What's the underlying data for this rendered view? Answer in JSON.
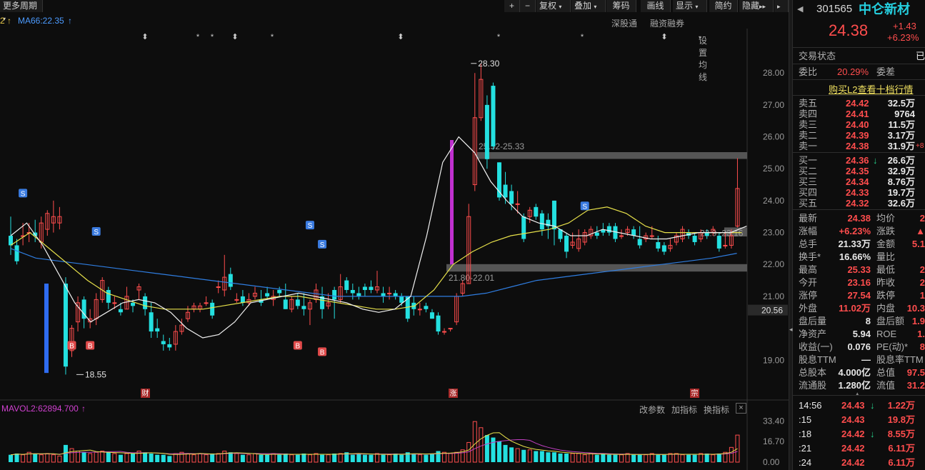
{
  "toolbar": {
    "period_label": "更多周期",
    "plus": "+",
    "minus": "−",
    "fq_label": "复权",
    "overlay_label": "叠加",
    "chips_label": "筹码",
    "draw_label": "画线",
    "display_label": "显示",
    "simple_label": "简约",
    "hide_label": "隐藏",
    "more_label": "▸▸"
  },
  "ma": {
    "ma_left": "2",
    "ma66_label": "MA66:22.35",
    "arrow": "↑"
  },
  "chart_links": {
    "shengu": "深股通",
    "rzrq": "融资融券",
    "settings": "设置均线"
  },
  "chart_data": {
    "type": "candlestick",
    "y_ticks": [
      "28.00",
      "27.00",
      "26.00",
      "25.00",
      "24.00",
      "23.00",
      "22.00",
      "21.00",
      "19.00"
    ],
    "current_price_tag": "20.56",
    "ylim": [
      18.2,
      28.9
    ],
    "annotations": {
      "high_label": "28.30",
      "low_label": "18.55",
      "upper_zone_label": "25.52-25.33",
      "lower_zone_label": "21.80-22.01",
      "right_zone_label": "22.9~23.16"
    },
    "event_labels": {
      "cai": "财",
      "zhang": "涨",
      "zong": "宗"
    },
    "signal_s": "S",
    "signal_b": "B",
    "star": "*",
    "diamond": "⬍",
    "volume": {
      "label": "MAVOL2:62894.700",
      "arrow": "↑",
      "ticks": [
        "33.40",
        "16.70",
        "0.00"
      ],
      "links": [
        "改参数",
        "加指标",
        "换指标"
      ],
      "close": "×"
    },
    "candles": [
      [
        22.9,
        22.6,
        23.5,
        22.3
      ],
      [
        22.6,
        22.1,
        22.8,
        22.0
      ],
      [
        22.9,
        22.9,
        23.3,
        22.6
      ],
      [
        23.0,
        23.0,
        23.3,
        22.7
      ],
      [
        23.0,
        22.9,
        23.4,
        22.7
      ],
      [
        22.7,
        23.3,
        23.5,
        22.5
      ],
      [
        23.1,
        23.6,
        23.7,
        22.9
      ],
      [
        23.3,
        23.5,
        24.0,
        23.0
      ],
      [
        23.3,
        23.5,
        23.8,
        23.1
      ],
      [
        21.4,
        18.8,
        21.6,
        18.55
      ],
      [
        19.3,
        20.0,
        20.1,
        19.1
      ],
      [
        20.2,
        20.8,
        21.0,
        19.9
      ],
      [
        20.9,
        20.3,
        21.0,
        20.0
      ],
      [
        20.2,
        20.3,
        20.6,
        20.0
      ],
      [
        20.3,
        20.9,
        21.1,
        20.1
      ],
      [
        20.9,
        21.5,
        21.6,
        20.8
      ],
      [
        21.2,
        20.8,
        21.3,
        20.6
      ],
      [
        20.8,
        20.8,
        21.0,
        20.6
      ],
      [
        20.6,
        20.5,
        20.8,
        20.4
      ],
      [
        20.6,
        21.0,
        21.3,
        20.6
      ],
      [
        20.8,
        20.7,
        20.9,
        20.5
      ],
      [
        21.2,
        21.3,
        21.4,
        20.9
      ],
      [
        21.0,
        20.6,
        21.1,
        20.4
      ],
      [
        20.5,
        19.9,
        20.8,
        19.7
      ],
      [
        20.0,
        19.9,
        20.3,
        19.7
      ],
      [
        19.6,
        19.5,
        19.8,
        19.3
      ],
      [
        19.5,
        19.4,
        19.7,
        19.3
      ],
      [
        19.5,
        19.9,
        20.1,
        19.3
      ],
      [
        19.9,
        20.1,
        20.3,
        19.8
      ],
      [
        20.3,
        20.5,
        20.7,
        20.2
      ],
      [
        20.6,
        20.7,
        20.8,
        20.5
      ],
      [
        20.6,
        20.7,
        20.8,
        20.5
      ],
      [
        20.8,
        20.8,
        21.0,
        20.7
      ],
      [
        20.8,
        20.4,
        20.9,
        20.3
      ],
      [
        21.3,
        21.3,
        21.5,
        21.1
      ],
      [
        21.2,
        21.6,
        22.3,
        21.0
      ],
      [
        21.7,
        21.3,
        21.9,
        21.2
      ],
      [
        20.9,
        20.9,
        21.1,
        20.8
      ],
      [
        21.0,
        20.8,
        21.2,
        20.7
      ],
      [
        20.8,
        20.9,
        21.1,
        20.7
      ],
      [
        21.0,
        21.1,
        21.3,
        20.9
      ],
      [
        20.9,
        20.8,
        21.2,
        20.7
      ],
      [
        21.1,
        21.0,
        21.3,
        20.9
      ],
      [
        20.9,
        21.0,
        21.2,
        20.7
      ],
      [
        21.2,
        21.1,
        21.3,
        21.0
      ],
      [
        20.9,
        20.6,
        21.4,
        20.6
      ],
      [
        20.6,
        20.9,
        21.0,
        20.5
      ],
      [
        20.9,
        20.7,
        21.1,
        20.6
      ],
      [
        20.7,
        20.6,
        21.1,
        20.4
      ],
      [
        20.6,
        20.8,
        20.9,
        20.1
      ],
      [
        20.9,
        21.2,
        21.4,
        20.8
      ],
      [
        21.0,
        20.6,
        21.3,
        20.3
      ],
      [
        20.7,
        20.8,
        21.1,
        20.6
      ],
      [
        21.2,
        20.9,
        21.3,
        20.3
      ],
      [
        20.9,
        21.3,
        21.7,
        20.8
      ],
      [
        21.5,
        21.2,
        21.6,
        21.1
      ],
      [
        21.2,
        21.1,
        21.4,
        20.9
      ],
      [
        21.1,
        21.0,
        21.3,
        20.9
      ],
      [
        21.3,
        21.2,
        21.4,
        21.0
      ],
      [
        21.3,
        21.2,
        21.5,
        21.1
      ],
      [
        21.2,
        21.3,
        21.8,
        21.1
      ],
      [
        21.1,
        21.0,
        21.3,
        20.8
      ],
      [
        21.1,
        21.1,
        21.3,
        20.9
      ],
      [
        21.1,
        21.0,
        21.2,
        20.9
      ],
      [
        21.0,
        20.8,
        21.1,
        20.7
      ],
      [
        21.0,
        20.3,
        21.0,
        20.2
      ],
      [
        20.8,
        20.6,
        21.0,
        20.4
      ],
      [
        20.6,
        20.6,
        20.8,
        20.4
      ],
      [
        20.7,
        20.6,
        20.8,
        20.5
      ],
      [
        20.5,
        20.3,
        20.6,
        20.3
      ],
      [
        20.4,
        19.9,
        20.5,
        19.8
      ],
      [
        19.9,
        19.9,
        20.0,
        19.8
      ],
      [
        20.0,
        20.0,
        20.0,
        19.9
      ],
      [
        20.2,
        21.0,
        21.1,
        20.1
      ],
      [
        21.1,
        21.4,
        21.5,
        21.0
      ],
      [
        21.4,
        23.5,
        23.9,
        21.4
      ],
      [
        24.5,
        26.6,
        28.0,
        24.3
      ],
      [
        26.6,
        27.8,
        28.3,
        26.5
      ],
      [
        27.0,
        25.3,
        27.3,
        25.0
      ],
      [
        27.6,
        25.7,
        27.7,
        25.6
      ],
      [
        25.2,
        24.1,
        25.2,
        24.0
      ],
      [
        24.5,
        24.1,
        24.9,
        23.9
      ],
      [
        24.3,
        23.9,
        24.5,
        23.7
      ],
      [
        23.9,
        23.9,
        24.3,
        23.6
      ],
      [
        23.5,
        22.8,
        23.6,
        22.7
      ],
      [
        23.5,
        23.7,
        23.8,
        23.3
      ],
      [
        23.8,
        23.5,
        23.9,
        23.4
      ],
      [
        23.6,
        23.1,
        23.7,
        22.9
      ],
      [
        23.4,
        23.2,
        23.6,
        22.8
      ],
      [
        24.0,
        23.1,
        24.0,
        22.6
      ],
      [
        23.1,
        22.8,
        23.1,
        22.7
      ],
      [
        22.9,
        22.4,
        23.0,
        22.2
      ],
      [
        22.6,
        22.7,
        23.0,
        22.5
      ],
      [
        22.5,
        22.8,
        23.1,
        22.4
      ],
      [
        22.7,
        23.0,
        23.1,
        22.6
      ],
      [
        22.9,
        23.1,
        23.2,
        22.8
      ],
      [
        23.0,
        22.9,
        23.2,
        22.8
      ],
      [
        23.1,
        23.0,
        23.3,
        22.9
      ],
      [
        23.2,
        23.0,
        23.3,
        22.9
      ],
      [
        23.2,
        22.8,
        23.3,
        22.7
      ],
      [
        22.9,
        22.9,
        23.1,
        22.8
      ],
      [
        23.0,
        23.1,
        23.2,
        22.9
      ],
      [
        23.1,
        22.9,
        23.2,
        22.8
      ],
      [
        22.8,
        22.6,
        23.2,
        22.5
      ],
      [
        22.8,
        22.9,
        23.0,
        22.7
      ],
      [
        22.9,
        22.9,
        23.2,
        22.8
      ],
      [
        22.7,
        22.5,
        22.9,
        22.4
      ],
      [
        22.6,
        22.4,
        22.7,
        22.3
      ],
      [
        22.5,
        22.6,
        22.8,
        22.4
      ],
      [
        22.7,
        22.9,
        23.0,
        22.6
      ],
      [
        22.8,
        23.1,
        23.2,
        22.7
      ],
      [
        23.0,
        22.9,
        23.1,
        22.8
      ],
      [
        22.9,
        22.7,
        23.0,
        22.6
      ],
      [
        22.8,
        23.0,
        23.1,
        22.7
      ],
      [
        23.0,
        22.9,
        23.1,
        22.8
      ],
      [
        23.0,
        23.1,
        23.2,
        22.9
      ],
      [
        22.9,
        22.5,
        23.0,
        22.4
      ],
      [
        22.6,
        22.6,
        23.0,
        22.5
      ],
      [
        22.6,
        22.9,
        23.1,
        22.5
      ],
      [
        23.2,
        24.38,
        25.33,
        23.16
      ]
    ],
    "lines": {
      "ma_white": [
        22.9,
        23.3,
        22.6,
        21.7,
        20.8,
        20.2,
        20.5,
        20.8,
        20.9,
        20.8,
        20.5,
        20.0,
        19.7,
        19.8,
        20.2,
        20.8,
        20.9,
        21.0,
        21.1,
        21.0,
        20.9,
        20.8,
        20.6,
        20.5,
        20.6,
        21.0,
        22.9,
        25.2,
        26.0,
        25.5,
        24.6,
        24.0,
        23.5,
        23.3,
        23.2,
        22.9,
        22.9,
        23.1,
        23.0,
        22.9,
        22.8,
        22.8,
        22.9,
        23.0,
        23.0,
        23.0,
        23.2
      ],
      "ma_yellow": [
        22.6,
        23.0,
        22.5,
        22.0,
        21.5,
        21.1,
        20.9,
        20.7,
        20.6,
        20.6,
        20.6,
        20.7,
        20.8,
        20.9,
        21.0,
        21.0,
        20.9,
        20.8,
        20.7,
        20.6,
        20.6,
        20.7,
        21.2,
        22.0,
        22.4,
        22.7,
        22.9,
        23.0,
        23.1,
        23.3,
        23.7,
        23.8,
        23.6,
        23.2,
        23.0,
        23.0,
        23.0,
        23.0,
        23.0
      ],
      "ma_blue": [
        22.5,
        22.2,
        22.1,
        22.0,
        21.9,
        21.8,
        21.7,
        21.6,
        21.5,
        21.4,
        21.3,
        21.2,
        21.1,
        21.0,
        21.0,
        21.0,
        21.0,
        21.0,
        21.0,
        21.1,
        21.3,
        21.5,
        21.6,
        21.7,
        21.8,
        21.9,
        22.0,
        22.1,
        22.2,
        22.35
      ]
    },
    "volumes": [
      6,
      7,
      6,
      8,
      7,
      6,
      7,
      6,
      5,
      14,
      11,
      9,
      8,
      7,
      8,
      9,
      8,
      7,
      6,
      7,
      7,
      9,
      8,
      7,
      6,
      6,
      5,
      7,
      8,
      7,
      6,
      7,
      6,
      7,
      7,
      9,
      8,
      7,
      6,
      6,
      7,
      6,
      6,
      7,
      6,
      7,
      6,
      6,
      7,
      6,
      7,
      6,
      6,
      7,
      7,
      8,
      6,
      7,
      6,
      6,
      7,
      6,
      6,
      7,
      6,
      8,
      7,
      6,
      6,
      7,
      9,
      8,
      7,
      8,
      10,
      16,
      33,
      28,
      22,
      20,
      17,
      14,
      12,
      11,
      10,
      10,
      9,
      9,
      8,
      8,
      7,
      7,
      7,
      7,
      6,
      7,
      6,
      7,
      6,
      6,
      6,
      7,
      6,
      6,
      6,
      7,
      6,
      6,
      7,
      7,
      6,
      6,
      6,
      7,
      7,
      6,
      7,
      8,
      12,
      22
    ]
  },
  "panel": {
    "code": "301565",
    "name": "中仑新材",
    "price": "24.38",
    "change": "+1.43",
    "change_pct": "+6.23%",
    "trade_status": "交易状态",
    "trade_status_val": "已",
    "weibi_label": "委比",
    "weibi_val": "20.29%",
    "weicha_label": "委差",
    "l2_link": "购买L2查看十档行情",
    "asks": [
      {
        "label": "卖五",
        "price": "24.42",
        "vol": "32.5万"
      },
      {
        "label": "卖四",
        "price": "24.41",
        "vol": "9764"
      },
      {
        "label": "卖三",
        "price": "24.40",
        "vol": "11.5万"
      },
      {
        "label": "卖二",
        "price": "24.39",
        "vol": "3.17万"
      },
      {
        "label": "卖一",
        "price": "24.38",
        "vol": "31.9万",
        "extra": "+8"
      }
    ],
    "bids": [
      {
        "label": "买一",
        "price": "24.36",
        "vol": "26.6万",
        "arrow": "↓"
      },
      {
        "label": "买二",
        "price": "24.35",
        "vol": "32.9万"
      },
      {
        "label": "买三",
        "price": "24.34",
        "vol": "8.76万"
      },
      {
        "label": "买四",
        "price": "24.33",
        "vol": "19.7万"
      },
      {
        "label": "买五",
        "price": "24.32",
        "vol": "32.6万"
      }
    ],
    "stats": [
      {
        "l": "最新",
        "v": "24.38",
        "vc": "red",
        "l2": "均价",
        "v2": "2"
      },
      {
        "l": "涨幅",
        "v": "+6.23%",
        "vc": "red",
        "l2": "涨跌",
        "v2": "▲"
      },
      {
        "l": "总手",
        "v": "21.33万",
        "vc": "white",
        "l2": "金额",
        "v2": "5.1"
      },
      {
        "l": "换手*",
        "v": "16.66%",
        "vc": "white",
        "l2": "量比",
        "v2": ""
      },
      {
        "l": "最高",
        "v": "25.33",
        "vc": "red",
        "l2": "最低",
        "v2": "2"
      },
      {
        "l": "今开",
        "v": "23.16",
        "vc": "red",
        "l2": "昨收",
        "v2": "2"
      },
      {
        "l": "涨停",
        "v": "27.54",
        "vc": "red",
        "l2": "跌停",
        "v2": "1"
      },
      {
        "l": "外盘",
        "v": "11.02万",
        "vc": "red",
        "l2": "内盘",
        "v2": "10.3"
      },
      {
        "l": "盘后量",
        "v": "8",
        "vc": "white",
        "l2": "盘后额",
        "v2": "1.9"
      },
      {
        "l": "净资产",
        "v": "5.94",
        "vc": "white",
        "l2": "ROE",
        "v2": "1."
      },
      {
        "l": "收益(一)",
        "v": "0.076",
        "vc": "white",
        "l2": "PE(动)*",
        "v2": "8"
      },
      {
        "l": "股息TTM",
        "v": "—",
        "vc": "white",
        "l2": "股息率TTM",
        "v2": ""
      },
      {
        "l": "总股本",
        "v": "4.000亿",
        "vc": "white",
        "l2": "总值",
        "v2": "97.5"
      },
      {
        "l": "流通股",
        "v": "1.280亿",
        "vc": "white",
        "l2": "流值",
        "v2": "31.2"
      }
    ],
    "ticks": [
      {
        "t": "14:56",
        "p": "24.43",
        "a": "↓",
        "v": "1.22万"
      },
      {
        "t": ":15",
        "p": "24.43",
        "a": "",
        "v": "19.8万"
      },
      {
        "t": ":18",
        "p": "24.42",
        "a": "↓",
        "v": "8.55万"
      },
      {
        "t": ":21",
        "p": "24.42",
        "a": "",
        "v": "6.11万"
      },
      {
        "t": ":24",
        "p": "24.42",
        "a": "",
        "v": "6.11万"
      }
    ],
    "collapse": "▴"
  }
}
